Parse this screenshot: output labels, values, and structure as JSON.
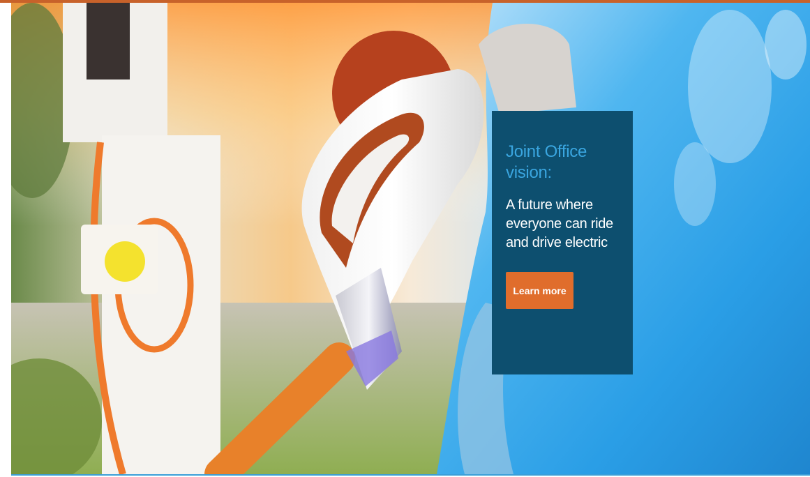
{
  "hero": {
    "image_icon": "ev-charging-photo-icon",
    "panel": {
      "heading": "Joint Office vision:",
      "tagline": "A future where everyone can ride and drive electric",
      "button_label": "Learn more"
    }
  },
  "colors": {
    "accent_orange": "#e06d2c",
    "panel_bg": "#0d4f6f",
    "heading_blue": "#3aa6e0",
    "top_bar": "#c8622a"
  }
}
